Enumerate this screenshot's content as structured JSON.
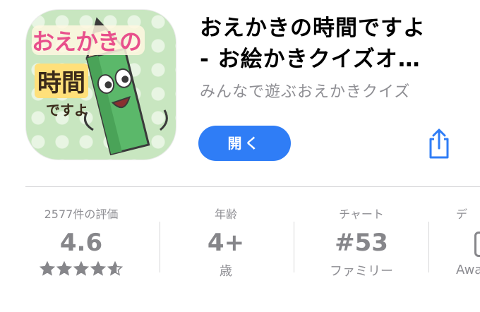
{
  "app": {
    "icon_label": "app-icon",
    "icon_text_main": "おえかきの",
    "icon_text_middle": "時間",
    "icon_text_small": "ですよ",
    "title_line1": "おえかきの時間ですよ",
    "title_line2": "- お絵かきクイズオ…",
    "subtitle": "みんなで遊ぶおえかきクイズ",
    "open_label": "開く",
    "share_icon": "share-icon"
  },
  "stats": {
    "ratings_label": "2577件の評価",
    "rating_value": "4.6",
    "rating_stars": 4.6,
    "age_label": "年齢",
    "age_value": "4+",
    "age_sub": "歳",
    "chart_label": "チャート",
    "chart_value": "#53",
    "chart_sub": "ファミリー",
    "dev_label": "デ",
    "dev_sub": "Awa"
  },
  "colors": {
    "accent": "#2f7df6",
    "secondary_text": "#8e8e93",
    "divider": "#d6d6d8"
  }
}
